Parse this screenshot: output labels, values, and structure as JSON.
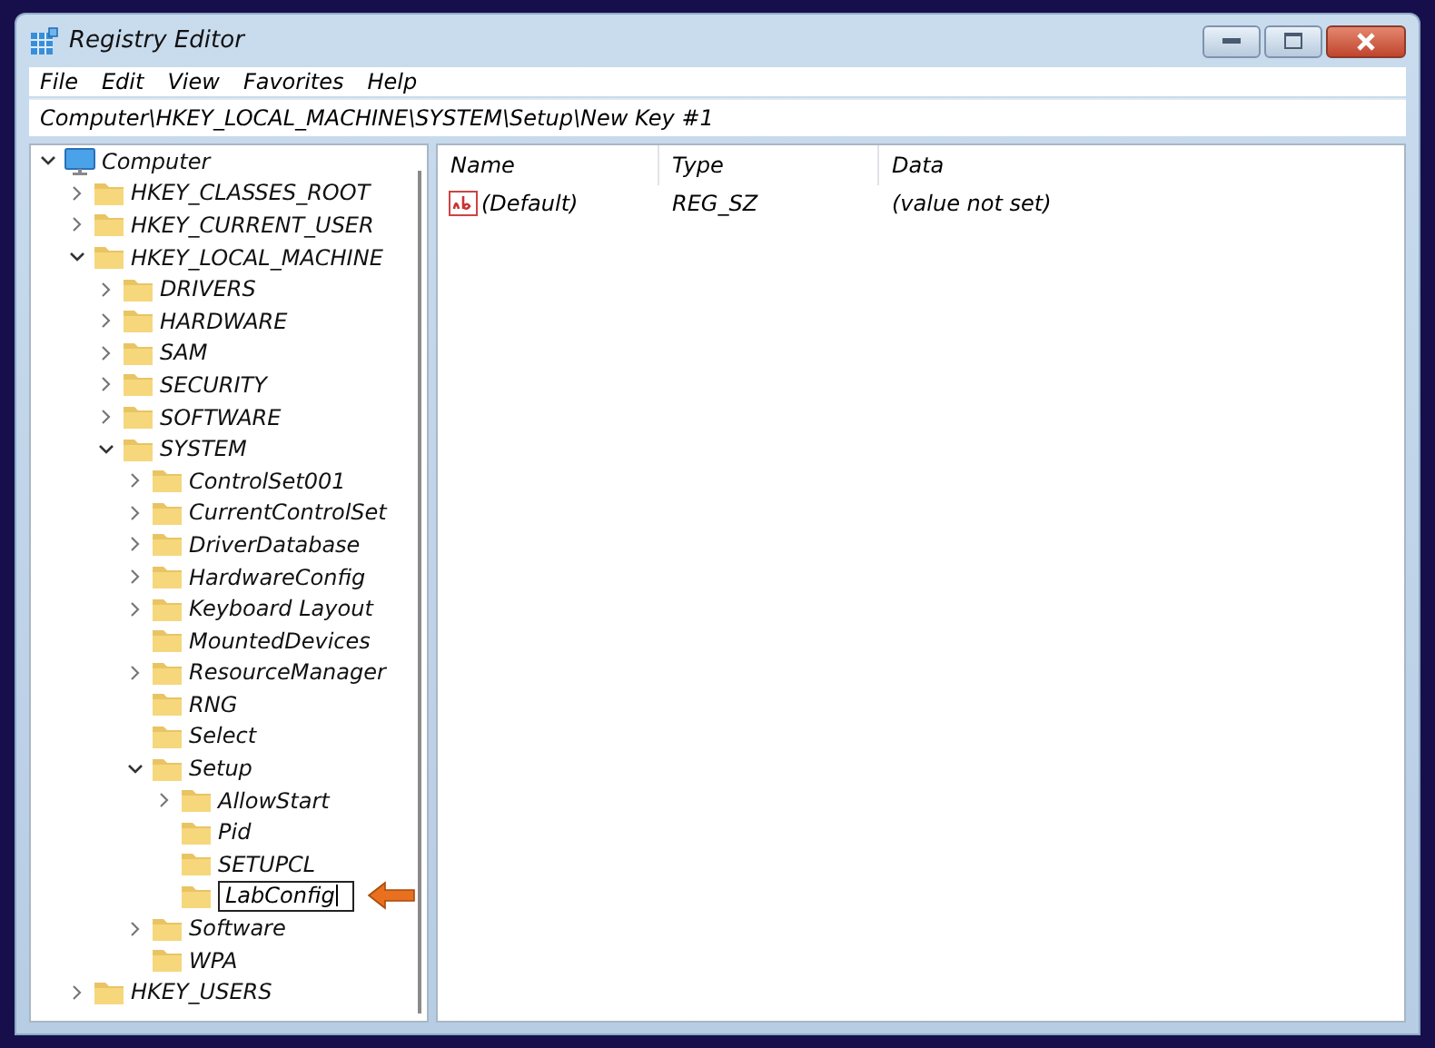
{
  "window": {
    "title": "Registry Editor"
  },
  "menu": [
    "File",
    "Edit",
    "View",
    "Favorites",
    "Help"
  ],
  "address": "Computer\\HKEY_LOCAL_MACHINE\\SYSTEM\\Setup\\New Key #1",
  "tree": [
    {
      "label": "Computer",
      "kind": "computer",
      "expanded": true,
      "children": [
        {
          "label": "HKEY_CLASSES_ROOT",
          "kind": "branch",
          "expanded": false
        },
        {
          "label": "HKEY_CURRENT_USER",
          "kind": "branch",
          "expanded": false
        },
        {
          "label": "HKEY_LOCAL_MACHINE",
          "kind": "branch",
          "expanded": true,
          "children": [
            {
              "label": "DRIVERS",
              "kind": "branch",
              "expanded": false
            },
            {
              "label": "HARDWARE",
              "kind": "branch",
              "expanded": false
            },
            {
              "label": "SAM",
              "kind": "branch",
              "expanded": false
            },
            {
              "label": "SECURITY",
              "kind": "branch",
              "expanded": false
            },
            {
              "label": "SOFTWARE",
              "kind": "branch",
              "expanded": false
            },
            {
              "label": "SYSTEM",
              "kind": "branch",
              "expanded": true,
              "children": [
                {
                  "label": "ControlSet001",
                  "kind": "branch",
                  "expanded": false
                },
                {
                  "label": "CurrentControlSet",
                  "kind": "branch",
                  "expanded": false
                },
                {
                  "label": "DriverDatabase",
                  "kind": "branch",
                  "expanded": false
                },
                {
                  "label": "HardwareConfig",
                  "kind": "branch",
                  "expanded": false
                },
                {
                  "label": "Keyboard Layout",
                  "kind": "branch",
                  "expanded": false
                },
                {
                  "label": "MountedDevices",
                  "kind": "leaf"
                },
                {
                  "label": "ResourceManager",
                  "kind": "branch",
                  "expanded": false
                },
                {
                  "label": "RNG",
                  "kind": "leaf"
                },
                {
                  "label": "Select",
                  "kind": "leaf"
                },
                {
                  "label": "Setup",
                  "kind": "branch",
                  "expanded": true,
                  "children": [
                    {
                      "label": "AllowStart",
                      "kind": "branch",
                      "expanded": false
                    },
                    {
                      "label": "Pid",
                      "kind": "leaf"
                    },
                    {
                      "label": "SETUPCL",
                      "kind": "leaf"
                    },
                    {
                      "label": "LabConfig",
                      "kind": "edit"
                    }
                  ]
                },
                {
                  "label": "Software",
                  "kind": "branch",
                  "expanded": false
                },
                {
                  "label": "WPA",
                  "kind": "leaf"
                }
              ]
            }
          ]
        },
        {
          "label": "HKEY_USERS",
          "kind": "branch",
          "expanded": false
        }
      ]
    }
  ],
  "columns": [
    "Name",
    "Type",
    "Data"
  ],
  "values": [
    {
      "name": "(Default)",
      "type": "REG_SZ",
      "data": "(value not set)"
    }
  ]
}
